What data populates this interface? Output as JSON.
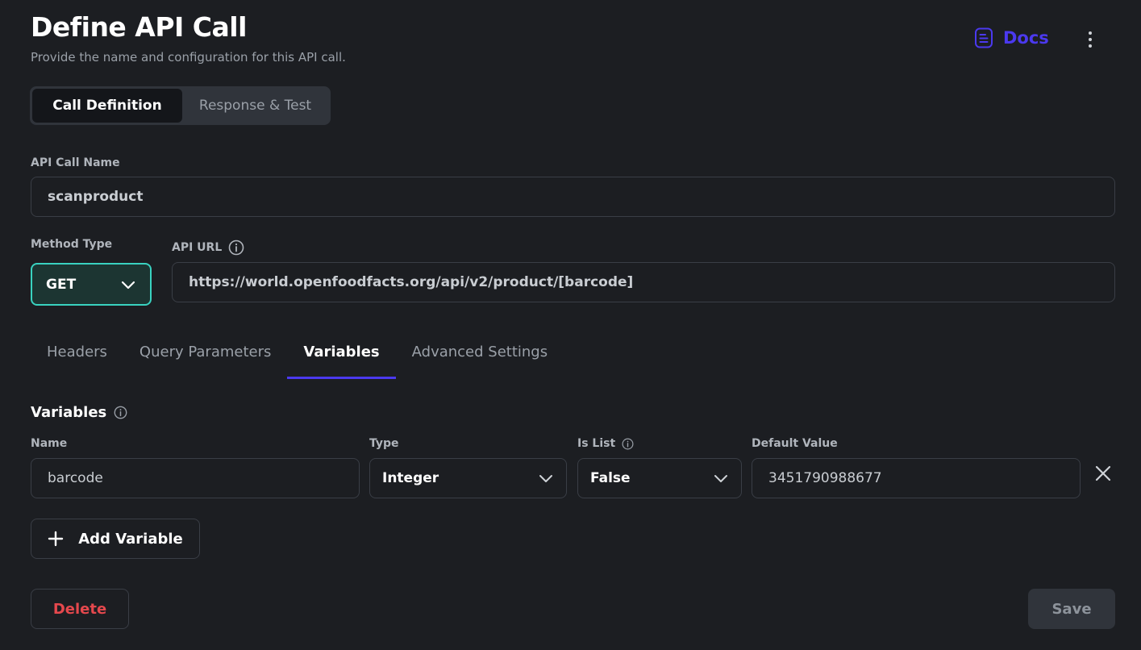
{
  "header": {
    "title": "Define API Call",
    "subtitle": "Provide the name and configuration for this API call.",
    "docs_label": "Docs"
  },
  "segments": [
    "Call Definition",
    "Response & Test"
  ],
  "form": {
    "name_label": "API Call Name",
    "name_value": "scanproduct",
    "method_label": "Method Type",
    "method_value": "GET",
    "url_label": "API URL",
    "url_value": "https://world.openfoodfacts.org/api/v2/product/[barcode]"
  },
  "tabs": [
    "Headers",
    "Query Parameters",
    "Variables",
    "Advanced Settings"
  ],
  "variables": {
    "heading": "Variables",
    "columns": {
      "name": "Name",
      "type": "Type",
      "is_list": "Is List",
      "default": "Default Value"
    },
    "rows": [
      {
        "name": "barcode",
        "type": "Integer",
        "is_list": "False",
        "default": "3451790988677"
      }
    ],
    "add_label": "Add Variable"
  },
  "footer": {
    "delete_label": "Delete",
    "save_label": "Save"
  },
  "colors": {
    "accent": "#4b39ef",
    "teal": "#39d2c0",
    "danger": "#e5484d",
    "background": "#1c1e22"
  }
}
